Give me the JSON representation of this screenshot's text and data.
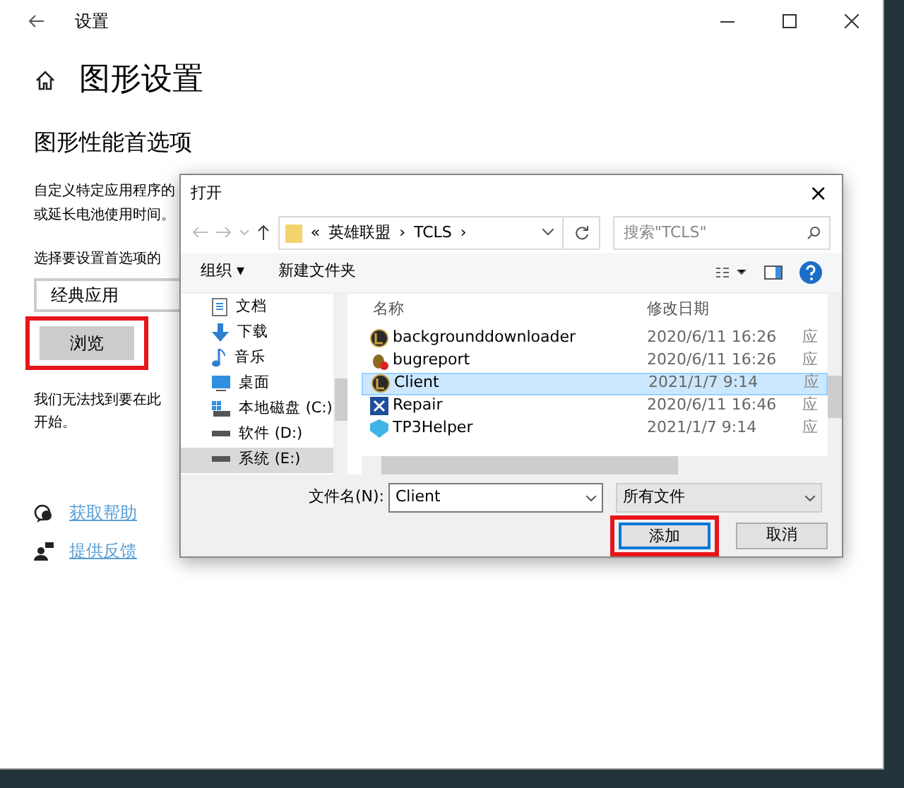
{
  "window": {
    "title": "设置",
    "heading": "图形设置",
    "subheading": "图形性能首选项"
  },
  "description_lines": [
    "自定义特定应用程序的",
    "或延长电池使用时间。"
  ],
  "select_label": "选择要设置首选项的",
  "app_type": {
    "value": "经典应用"
  },
  "browse_button": {
    "label": "浏览",
    "highlighted": true
  },
  "notice_lines": [
    "我们无法找到要在此",
    "开始。"
  ],
  "links": [
    "获取帮助",
    "提供反馈"
  ],
  "dialog": {
    "title": "打开",
    "close": "×",
    "breadcrumb": [
      {
        "label": "«"
      },
      {
        "label": "英雄联盟"
      },
      {
        "label": "›"
      },
      {
        "label": "TCLS"
      },
      {
        "label": "›"
      }
    ],
    "search": {
      "placeholder": "搜索\"TCLS\""
    },
    "toolbar": [
      {
        "label": "组织 ▾"
      },
      {
        "label": "新建文件夹"
      }
    ],
    "nav_items": [
      {
        "label": "文档",
        "kind": "doc",
        "selected": false
      },
      {
        "label": "下载",
        "kind": "download",
        "selected": false
      },
      {
        "label": "音乐",
        "kind": "music",
        "selected": false
      },
      {
        "label": "桌面",
        "kind": "desktop",
        "selected": false
      },
      {
        "label": "本地磁盘 (C:)",
        "kind": "system-drive",
        "selected": false
      },
      {
        "label": "软件 (D:)",
        "kind": "drive",
        "selected": false
      },
      {
        "label": "系统 (E:)",
        "kind": "drive",
        "selected": true
      }
    ],
    "columns": [
      "名称",
      "修改日期"
    ],
    "files": [
      {
        "name": "backgrounddownloader",
        "date": "2020/6/11 16:26",
        "column_3": "应",
        "kind": "league",
        "selected": false
      },
      {
        "name": "bugreport",
        "date": "2020/6/11 16:26",
        "column_3": "应",
        "kind": "bug",
        "selected": false
      },
      {
        "name": "Client",
        "date": "2021/1/7 9:14",
        "column_3": "应",
        "kind": "league",
        "selected": true
      },
      {
        "name": "Repair",
        "date": "2020/6/11 16:46",
        "column_3": "应",
        "kind": "repair",
        "selected": false
      },
      {
        "name": "TP3Helper",
        "date": "2021/1/7 9:14",
        "column_3": "应",
        "kind": "tp",
        "selected": false
      }
    ],
    "filename_label": "文件名(N):",
    "filename": "Client",
    "filter": "所有文件",
    "buttons": [
      {
        "label": "添加",
        "highlighted": true
      },
      {
        "label": "取消",
        "highlighted": false
      }
    ]
  }
}
